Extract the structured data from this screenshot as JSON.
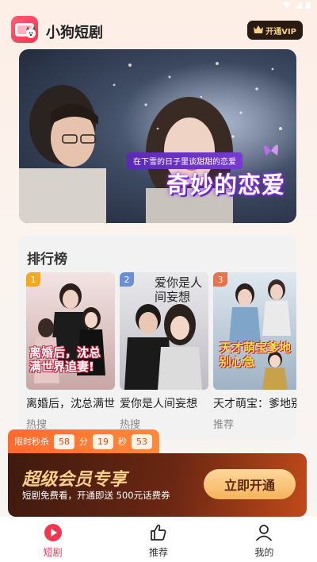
{
  "app": {
    "title": "小狗短剧",
    "vip_label": "开通VIP"
  },
  "banner": {
    "title": "奇妙的恋爱",
    "subtitle": "在下雪的日子里谈甜甜的恋爱"
  },
  "ranking": {
    "heading": "排行榜",
    "items": [
      {
        "rank": "1",
        "name": "离婚后，沈总满世界追妻！",
        "tag": "热搜",
        "badge_color": "#f5a623",
        "poster_text": "离婚后，沈总满世界追妻!"
      },
      {
        "rank": "2",
        "name": "爱你是人间妄想",
        "tag": "热搜",
        "badge_color": "#6b8fd6",
        "poster_text": "爱你是人间妄想"
      },
      {
        "rank": "3",
        "name": "天才萌宝：爹地别心急",
        "tag": "推荐",
        "badge_color": "#e8734a",
        "poster_text": "天才萌宝爹地别心急"
      }
    ]
  },
  "flash_sale": {
    "label": "限时秒杀",
    "hours": "58",
    "hours_unit": "分",
    "minutes": "19",
    "minutes_unit": "秒",
    "seconds": "53"
  },
  "promo": {
    "title": "超级会员专享",
    "subtitle": "短剧免费看，开通即送 500元话费券",
    "button": "立即开通"
  },
  "tabs": [
    {
      "label": "短剧",
      "icon": "play-circle-icon",
      "active": true
    },
    {
      "label": "推荐",
      "icon": "thumbs-up-icon",
      "active": false
    },
    {
      "label": "我的",
      "icon": "person-icon",
      "active": false
    }
  ],
  "colors": {
    "accent": "#f0374f",
    "promo_gold": "#f7cf8a"
  }
}
